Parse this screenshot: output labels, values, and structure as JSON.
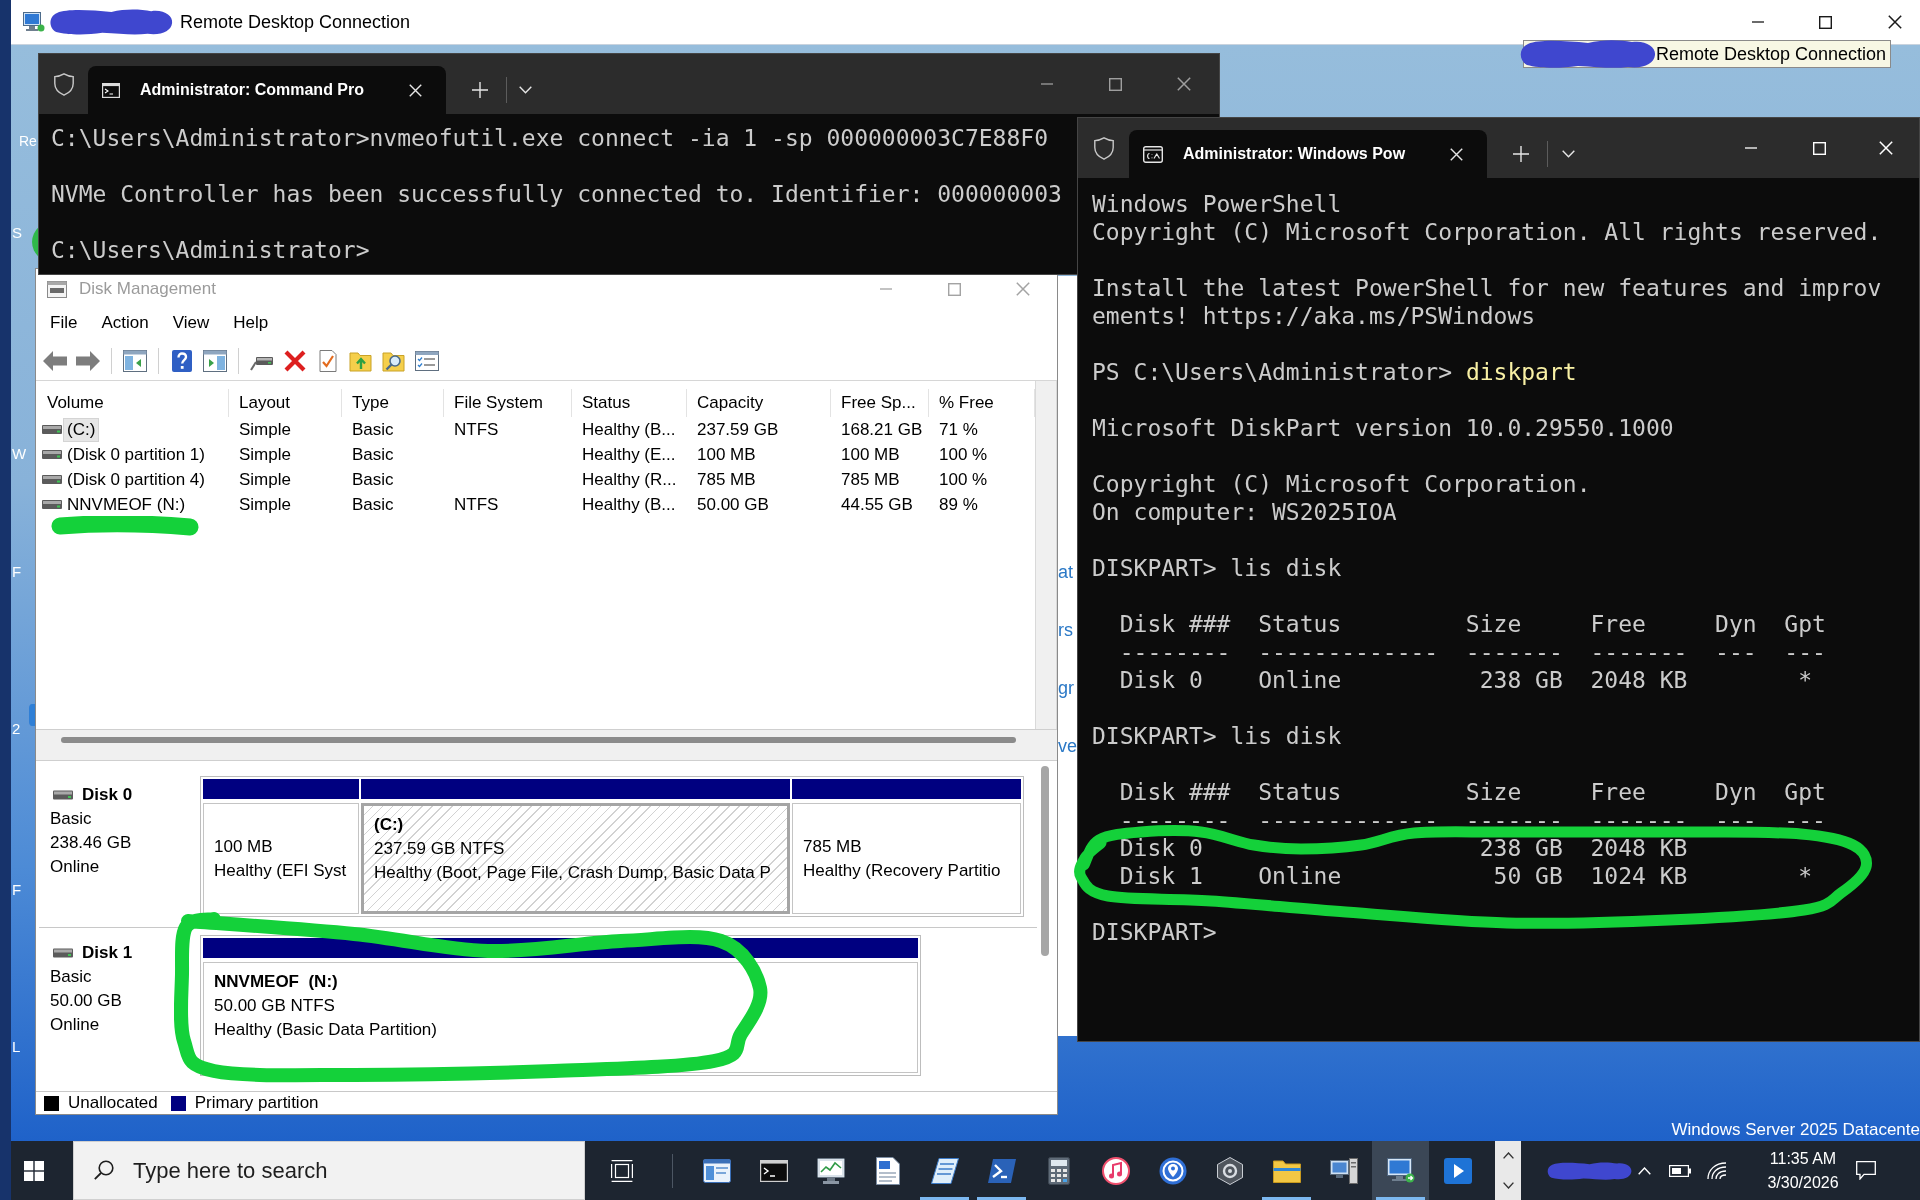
{
  "remote_desktop": {
    "title": "Remote Desktop Connection"
  },
  "tooltip": {
    "text": "Remote Desktop Connection"
  },
  "desktop": {
    "icon_labels": [
      "Re"
    ],
    "edge_fragments": [
      "S",
      "W",
      "F",
      "2",
      "F",
      "L"
    ],
    "edition": "Windows Server 2025 Datacente"
  },
  "background_window": {
    "text_fragments": [
      "at",
      "rs",
      "gr",
      "ve"
    ]
  },
  "command_prompt": {
    "tab_title": "Administrator: Command Pro",
    "blocks": [
      [
        {
          "kind": "output",
          "text": "C:\\Users\\Administrator>nvmeofutil.exe connect -ia 1 -sp 000000003C7E88F0"
        }
      ],
      [
        {
          "kind": "output",
          "text": "NVMe Controller has been successfully connected to. Identifier: 000000003"
        }
      ],
      [
        {
          "kind": "output",
          "text": "C:\\Users\\Administrator>"
        }
      ]
    ]
  },
  "disk_management": {
    "title": "Disk Management",
    "menu": [
      "File",
      "Action",
      "View",
      "Help"
    ],
    "columns": [
      "Volume",
      "Layout",
      "Type",
      "File System",
      "Status",
      "Capacity",
      "Free Sp...",
      "% Free"
    ],
    "volumes": [
      {
        "selected": true,
        "volume": "(C:)",
        "layout": "Simple",
        "type": "Basic",
        "file_system": "NTFS",
        "status": "Healthy (B...",
        "capacity": "237.59 GB",
        "free_space": "168.21 GB",
        "percent_free": "71 %"
      },
      {
        "selected": false,
        "volume": "(Disk 0 partition 1)",
        "layout": "Simple",
        "type": "Basic",
        "status": "Healthy (E...",
        "capacity": "100 MB",
        "free_space": "100 MB",
        "percent_free": "100 %"
      },
      {
        "selected": false,
        "volume": "(Disk 0 partition 4)",
        "layout": "Simple",
        "type": "Basic",
        "status": "Healthy (R...",
        "capacity": "785 MB",
        "free_space": "785 MB",
        "percent_free": "100 %"
      },
      {
        "selected": false,
        "volume": "NNVMEOF (N:)",
        "layout": "Simple",
        "type": "Basic",
        "file_system": "NTFS",
        "status": "Healthy (B...",
        "capacity": "50.00 GB",
        "free_space": "44.55 GB",
        "percent_free": "89 %"
      }
    ],
    "disks": [
      {
        "name": "Disk 0",
        "type": "Basic",
        "size": "238.46 GB",
        "status": "Online",
        "partitions": [
          {
            "selected": false,
            "size": "100 MB",
            "status": "Healthy (EFI Syst"
          },
          {
            "selected": true,
            "name": "(C:)",
            "size": "237.59 GB NTFS",
            "status": "Healthy (Boot, Page File, Crash Dump, Basic Data P"
          },
          {
            "selected": false,
            "size": "785 MB",
            "status": "Healthy (Recovery Partitio"
          }
        ]
      },
      {
        "name": "Disk 1",
        "type": "Basic",
        "size": "50.00 GB",
        "status": "Online",
        "partitions": [
          {
            "selected": false,
            "name": "NNVMEOF  (N:)",
            "size": "50.00 GB NTFS",
            "status": "Healthy (Basic Data Partition)"
          }
        ]
      }
    ],
    "legend": [
      {
        "label": "Unallocated",
        "color": "#000000"
      },
      {
        "label": "Primary partition",
        "color": "#000080"
      }
    ]
  },
  "powershell": {
    "tab_title": "Administrator: Windows Pow",
    "blocks": [
      [
        {
          "kind": "output",
          "text": "Windows PowerShell"
        },
        {
          "kind": "output",
          "text": "Copyright (C) Microsoft Corporation. All rights reserved."
        }
      ],
      [
        {
          "kind": "output",
          "text": "Install the latest PowerShell for new features and improv"
        },
        {
          "kind": "output",
          "text": "ements! https://aka.ms/PSWindows"
        }
      ],
      [
        {
          "kind": "command",
          "prompt": "PS C:\\Users\\Administrator>",
          "command": "diskpart"
        }
      ],
      [
        {
          "kind": "output",
          "text": "Microsoft DiskPart version 10.0.29550.1000"
        }
      ],
      [
        {
          "kind": "output",
          "text": "Copyright (C) Microsoft Corporation."
        },
        {
          "kind": "output",
          "text": "On computer: WS2025IOA"
        }
      ],
      [
        {
          "kind": "output",
          "text": "DISKPART> lis disk"
        }
      ],
      [
        {
          "kind": "indented",
          "text": "Disk ###  Status         Size     Free     Dyn  Gpt"
        },
        {
          "kind": "indented",
          "text": "--------  -------------  -------  -------  ---  ---"
        },
        {
          "kind": "indented",
          "text": "Disk 0    Online          238 GB  2048 KB        *"
        }
      ],
      [
        {
          "kind": "output",
          "text": "DISKPART> lis disk"
        }
      ],
      [
        {
          "kind": "indented",
          "text": "Disk ###  Status         Size     Free     Dyn  Gpt"
        },
        {
          "kind": "indented",
          "text": "--------  -------------  -------  -------  ---  ---"
        },
        {
          "kind": "gapped",
          "parts": [
            "Disk 0",
            "238 GB  2048 KB"
          ]
        },
        {
          "kind": "indented",
          "text": "Disk 1    Online           50 GB  1024 KB        *"
        }
      ],
      [
        {
          "kind": "output",
          "text": "DISKPART>"
        }
      ]
    ]
  },
  "taskbar": {
    "search": {
      "placeholder": "Type here to search"
    },
    "apps": [
      {
        "kind": "console",
        "running": false,
        "selected": false
      },
      {
        "kind": "cmd",
        "running": false,
        "selected": false
      },
      {
        "kind": "perfmon",
        "running": false,
        "selected": false
      },
      {
        "kind": "wordpad",
        "running": false,
        "selected": false
      },
      {
        "kind": "notes",
        "running": true,
        "selected": false
      },
      {
        "kind": "powershell",
        "running": true,
        "selected": false
      },
      {
        "kind": "calculator",
        "running": false,
        "selected": false
      },
      {
        "kind": "music",
        "running": false,
        "selected": false
      },
      {
        "kind": "ipscan",
        "running": false,
        "selected": false
      },
      {
        "kind": "hexagon",
        "running": false,
        "selected": false
      },
      {
        "kind": "explorer",
        "running": true,
        "selected": false
      },
      {
        "kind": "servermanager",
        "running": false,
        "selected": false
      },
      {
        "kind": "remotedesktop",
        "running": true,
        "selected": true
      },
      {
        "kind": "mediaplayer",
        "running": false,
        "selected": false
      }
    ],
    "clock": {
      "time": "11:35 AM",
      "date": "3/30/2026"
    }
  }
}
